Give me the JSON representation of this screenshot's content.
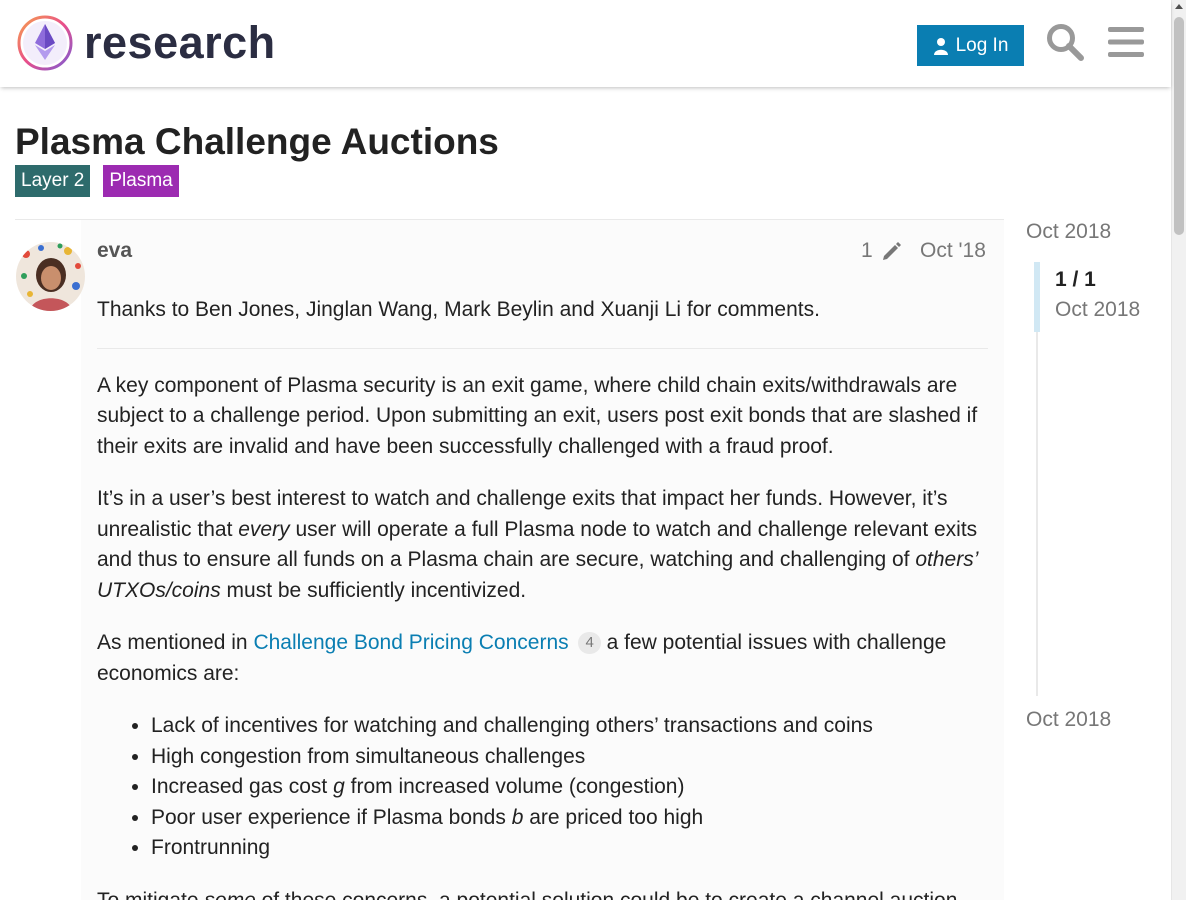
{
  "header": {
    "logo_text": "research",
    "login_label": "Log In",
    "accent_color": "#0a7eb2"
  },
  "topic": {
    "title": "Plasma Challenge Auctions",
    "tags": [
      "Layer 2",
      "Plasma"
    ]
  },
  "post": {
    "username": "eva",
    "edit_count": "1",
    "date": "Oct '18",
    "thanks": "Thanks to Ben Jones, Jinglan Wang, Mark Beylin and Xuanji Li for comments.",
    "para1": "A key component of Plasma security is an exit game, where child chain exits/withdrawals are subject to a challenge period. Upon submitting an exit, users post exit bonds that are slashed if their exits are invalid and have been successfully challenged with a fraud proof.",
    "para2_a": "It’s in a user’s best interest to watch and challenge exits that impact her funds. However, it’s unrealistic that ",
    "para2_em1": "every",
    "para2_b": " user will operate a full Plasma node to watch and challenge relevant exits and thus to ensure all funds on a Plasma chain are secure, watching and challenging of ",
    "para2_em2": "others’ UTXOs/coins",
    "para2_c": " must be sufficiently incentivized.",
    "para3_a": "As mentioned in ",
    "para3_link": "Challenge Bond Pricing Concerns",
    "para3_count": "4",
    "para3_b": " a few potential issues with challenge economics are:",
    "list": {
      "item1": "Lack of incentives for watching and challenging others’ transactions and coins",
      "item2": "High congestion from simultaneous challenges",
      "item3_a": "Increased gas cost ",
      "item3_em": "g",
      "item3_b": " from increased volume (congestion)",
      "item4_a": "Poor user experience if Plasma bonds ",
      "item4_em": "b",
      "item4_b": " are priced too high",
      "item5": "Frontrunning"
    },
    "para4_a": "To mitigate ",
    "para4_em": "some",
    "para4_b": " of these concerns, a potential solution could be to create a channel auction"
  },
  "timeline": {
    "top_date": "Oct 2018",
    "counter": "1 / 1",
    "current_date": "Oct 2018",
    "bottom_date": "Oct 2018"
  }
}
